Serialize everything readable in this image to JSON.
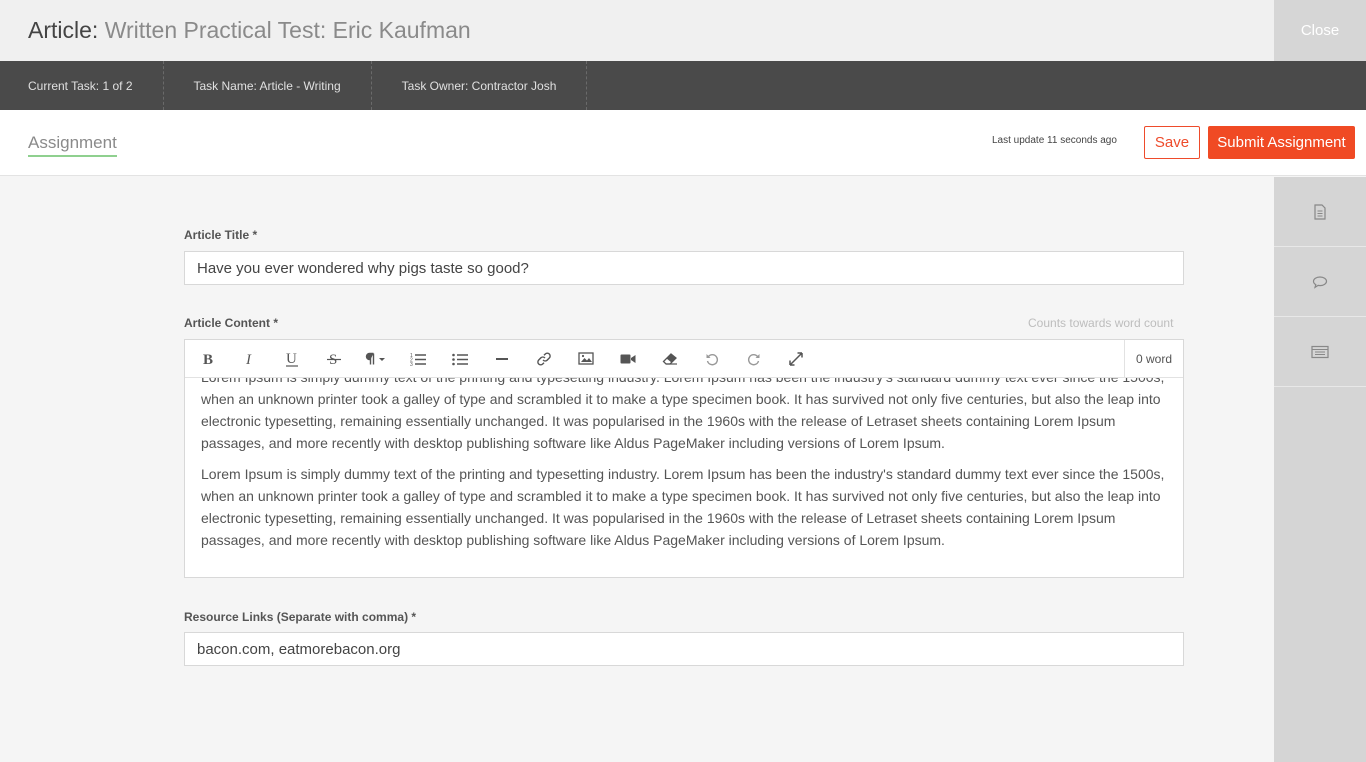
{
  "header": {
    "title_prefix": "Article:",
    "title_text": "Written Practical Test: Eric Kaufman",
    "close_label": "Close"
  },
  "taskbar": {
    "current_task": "Current Task: 1 of 2",
    "task_name": "Task Name: Article - Writing",
    "task_owner": "Task Owner: Contractor Josh"
  },
  "subbar": {
    "tab_label": "Assignment",
    "last_update": "Last update 11 seconds ago",
    "save_label": "Save",
    "submit_label": "Submit Assignment"
  },
  "form": {
    "title_label": "Article Title *",
    "title_value": "Have you ever wondered why pigs taste so good?",
    "content_label": "Article Content *",
    "counts_hint": "Counts towards word count",
    "word_count": "0 word",
    "paragraphs": [
      "Lorem Ipsum is simply dummy text of the printing and typesetting industry. Lorem Ipsum has been the industry's standard dummy text ever since the 1500s, when an unknown printer took a galley of type and scrambled it to make a type specimen book. It has survived not only five centuries, but also the leap into electronic typesetting, remaining essentially unchanged. It was popularised in the 1960s with the release of Letraset sheets containing Lorem Ipsum passages, and more recently with desktop publishing software like Aldus PageMaker including versions of Lorem Ipsum.",
      "Lorem Ipsum is simply dummy text of the printing and typesetting industry. Lorem Ipsum has been the industry's standard dummy text ever since the 1500s, when an unknown printer took a galley of type and scrambled it to make a type specimen book. It has survived not only five centuries, but also the leap into electronic typesetting, remaining essentially unchanged. It was popularised in the 1960s with the release of Letraset sheets containing Lorem Ipsum passages, and more recently with desktop publishing software like Aldus PageMaker including versions of Lorem Ipsum."
    ],
    "resources_label": "Resource Links (Separate with comma) *",
    "resources_value": "bacon.com, eatmorebacon.org"
  },
  "toolbar_icons": [
    "bold-icon",
    "italic-icon",
    "underline-icon",
    "strikethrough-icon",
    "paragraph-icon",
    "ordered-list-icon",
    "unordered-list-icon",
    "horizontal-rule-icon",
    "link-icon",
    "image-icon",
    "video-icon",
    "eraser-icon",
    "undo-icon",
    "redo-icon",
    "fullscreen-icon"
  ],
  "sidebar_icons": [
    "document-icon",
    "comment-icon",
    "list-icon"
  ],
  "colors": {
    "accent": "#f04a24",
    "taskbar_bg": "#4a4a4a",
    "tab_underline": "#8fd08f"
  }
}
